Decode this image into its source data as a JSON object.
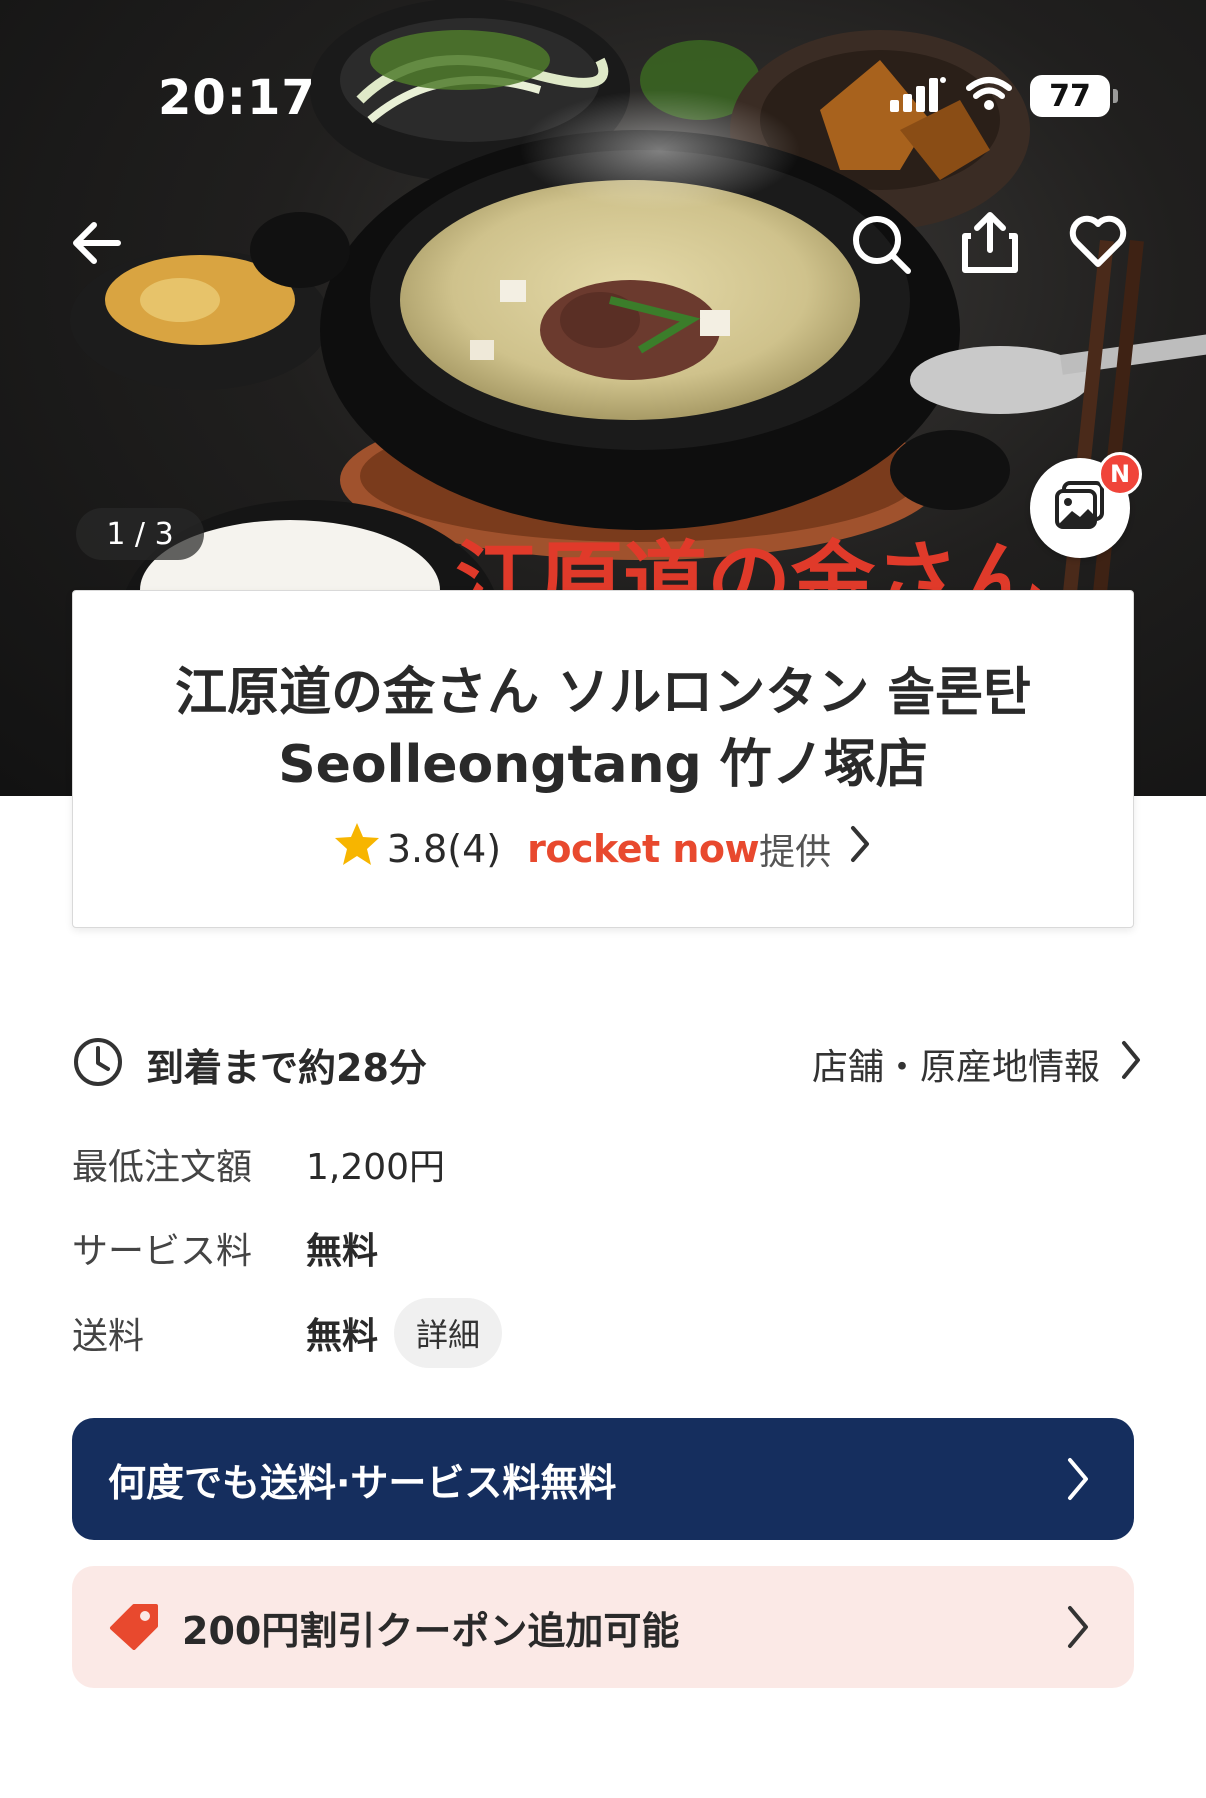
{
  "status_bar": {
    "time": "20:17",
    "battery": "77"
  },
  "hero": {
    "photo_counter": "1 / 3",
    "gallery_badge": "N",
    "overlay_text": "江原道の金さん"
  },
  "store": {
    "name": "江原道の金さん ソルロンタン 솔론탄 Seolleongtang 竹ノ塚店",
    "rating": "3.8(4)",
    "brand": "rocket now",
    "provided_label": "提供"
  },
  "delivery": {
    "eta": "到着まで約28分",
    "store_info_link": "店舗・原産地情報"
  },
  "fees": {
    "min_order_label": "最低注文額",
    "min_order_value": "1,200円",
    "service_label": "サービス料",
    "service_value": "無料",
    "shipping_label": "送料",
    "shipping_value": "無料",
    "detail_button": "詳細"
  },
  "banners": {
    "wow": "何度でも送料·サービス料無料",
    "coupon": "200円割引クーポン追加可能"
  },
  "colors": {
    "brand_red": "#e8492e",
    "navy": "#152e5e",
    "coupon_bg": "#fbe9e6",
    "star": "#f7b500",
    "badge_red": "#f0443a"
  },
  "icons": [
    "back-arrow-icon",
    "search-icon",
    "share-icon",
    "heart-icon",
    "gallery-icon",
    "star-icon",
    "clock-icon",
    "chevron-right-icon",
    "tag-icon"
  ]
}
